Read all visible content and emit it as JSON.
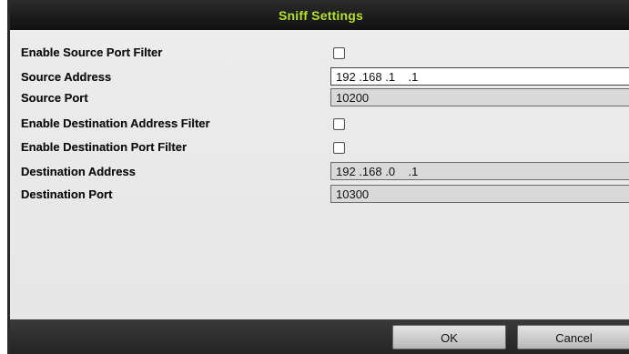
{
  "dialog": {
    "title": "Sniff Settings",
    "title_color": "#b6e12b"
  },
  "fields": {
    "enable_source_port_filter": {
      "label": "Enable Source Port Filter",
      "checked": false
    },
    "source_address": {
      "label": "Source Address",
      "value": "192 .168 .1    .1"
    },
    "source_port": {
      "label": "Source Port",
      "value": "10200"
    },
    "enable_destination_address_filter": {
      "label": "Enable Destination Address Filter",
      "checked": false
    },
    "enable_destination_port_filter": {
      "label": "Enable Destination Port Filter",
      "checked": false
    },
    "destination_address": {
      "label": "Destination Address",
      "value": "192 .168 .0    .1"
    },
    "destination_port": {
      "label": "Destination Port",
      "value": "10300"
    }
  },
  "buttons": {
    "ok": "OK",
    "cancel": "Cancel"
  }
}
